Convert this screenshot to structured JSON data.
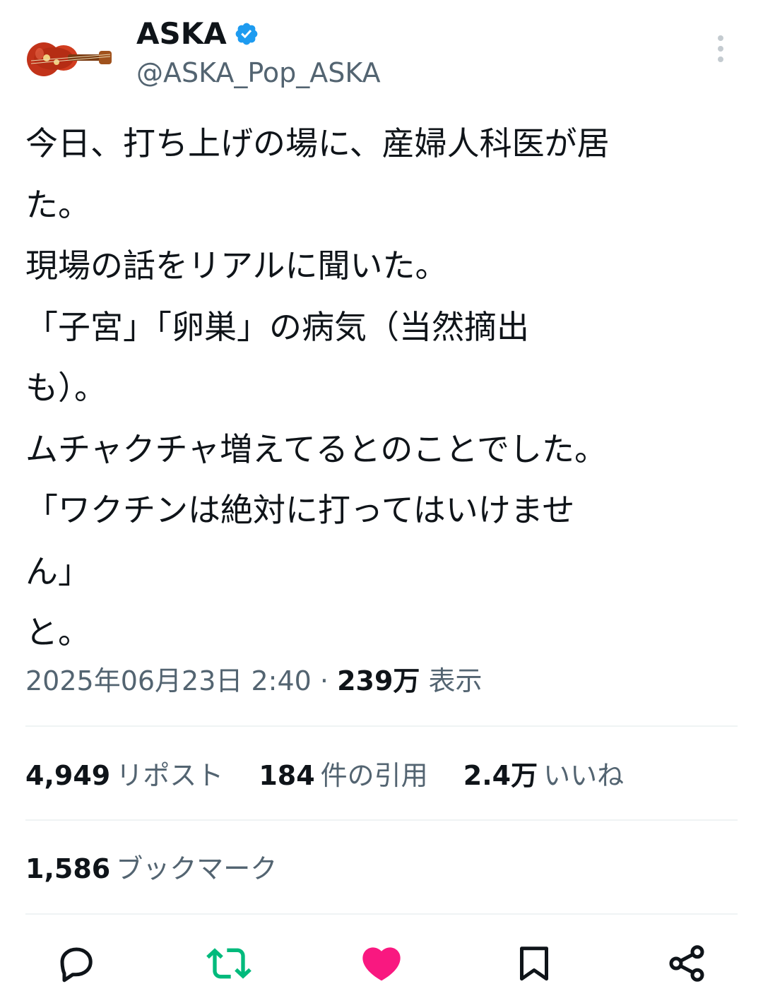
{
  "author": {
    "name": "ASKA",
    "handle": "@ASKA_Pop_ASKA",
    "avatar_icon": "guitar-icon",
    "verified_icon": "verified-badge-icon"
  },
  "tweet": {
    "text": "今日、打ち上げの場に、産婦人科医が居\nた。\n現場の話をリアルに聞いた。\n「子宮」「卵巣」の病気（当然摘出\nも）。\nムチャクチャ増えてるとのことでした。\n「ワクチンは絶対に打ってはいけませ\nん」\nと。"
  },
  "meta": {
    "timestamp": "2025年06月23日 2:40",
    "separator": "·",
    "views": "239万",
    "views_label": "表示"
  },
  "stats": {
    "reposts": "4,949",
    "reposts_label": "リポスト",
    "quotes": "184",
    "quotes_label": "件の引用",
    "likes": "2.4万",
    "likes_label": "いいね",
    "bookmarks": "1,586",
    "bookmarks_label": "ブックマーク"
  },
  "actions": {
    "reply_icon": "reply-icon",
    "retweet_icon": "retweet-icon",
    "like_icon": "heart-icon",
    "bookmark_icon": "bookmark-icon",
    "share_icon": "share-icon"
  },
  "colors": {
    "text_primary": "#0f1419",
    "text_secondary": "#536471",
    "verified": "#1d9bf0",
    "retweet_active": "#00ba7c",
    "like_active": "#f91880",
    "divider": "#eff3f4"
  }
}
